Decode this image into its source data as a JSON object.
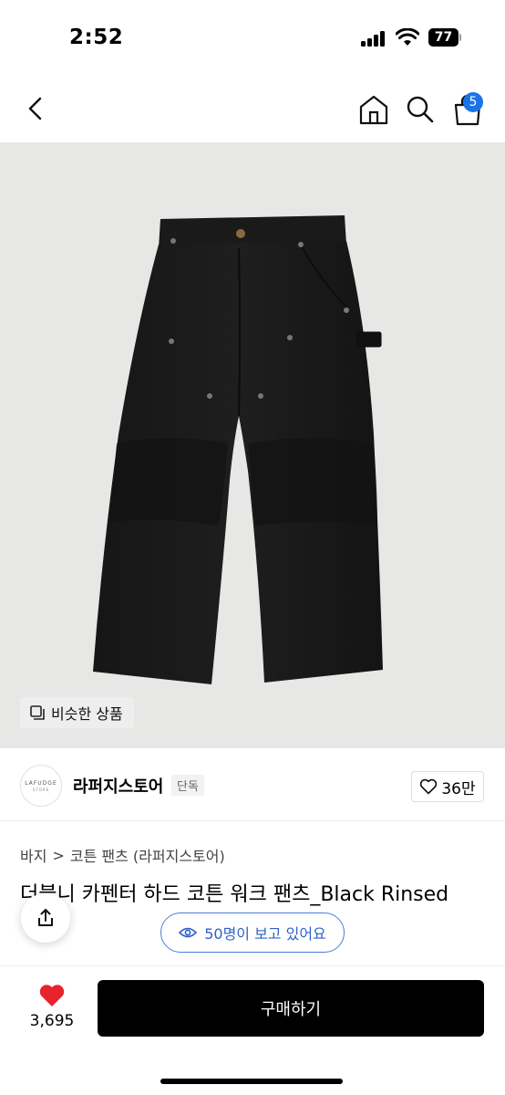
{
  "status_bar": {
    "time": "2:52",
    "battery": "77"
  },
  "nav": {
    "cart_count": "5"
  },
  "image": {
    "similar_label": "비슷한 상품"
  },
  "store": {
    "logo_line1": "LAFUDGE",
    "logo_line2": "STORE",
    "name": "라퍼지스토어",
    "badge": "단독",
    "likes": "36만"
  },
  "breadcrumb": {
    "category": "바지",
    "separator": ">",
    "subcategory": "코튼 팬츠 (라퍼지스토어)"
  },
  "product": {
    "title": "더블니 카펜터 하드 코튼 워크 팬츠_Black Rinsed"
  },
  "viewers": {
    "label": "50명이 보고 있어요"
  },
  "bottom": {
    "wish_count": "3,695",
    "buy_label": "구매하기"
  },
  "colors": {
    "accent_blue": "#1a73e8",
    "heart_red": "#e8232e",
    "image_bg": "#e7e7e6"
  }
}
